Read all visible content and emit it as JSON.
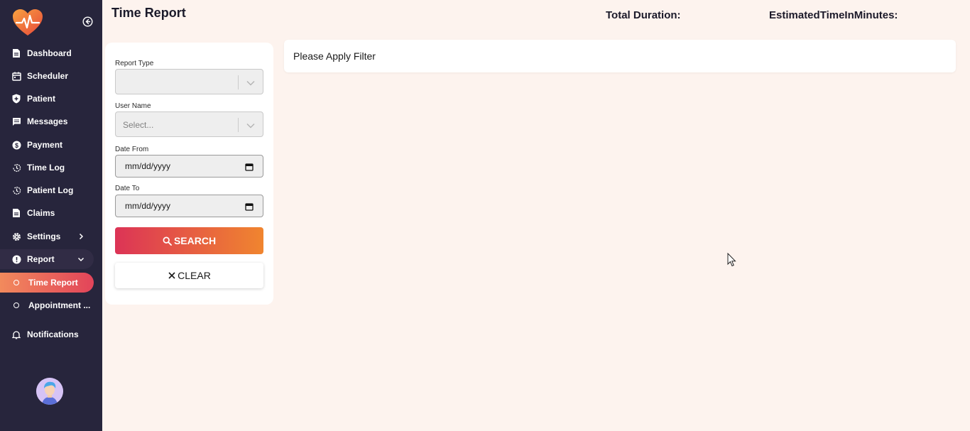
{
  "sidebar": {
    "items": [
      {
        "label": "Dashboard",
        "icon": "document-icon"
      },
      {
        "label": "Scheduler",
        "icon": "calendar-icon"
      },
      {
        "label": "Patient",
        "icon": "shield-icon"
      },
      {
        "label": "Messages",
        "icon": "message-icon"
      },
      {
        "label": "Payment",
        "icon": "dollar-icon"
      },
      {
        "label": "Time Log",
        "icon": "history-icon"
      },
      {
        "label": "Patient Log",
        "icon": "history-icon"
      },
      {
        "label": "Claims",
        "icon": "document-icon"
      },
      {
        "label": "Settings",
        "icon": "gear-icon"
      },
      {
        "label": "Report",
        "icon": "alert-icon"
      }
    ],
    "sub_items": [
      {
        "label": "Time Report"
      },
      {
        "label": "Appointment ..."
      }
    ],
    "notifications": {
      "label": "Notifications",
      "icon": "bell-icon"
    }
  },
  "header": {
    "title": "Time Report",
    "total_duration_label": "Total Duration:",
    "estimated_time_label": "EstimatedTimeInMinutes:"
  },
  "filters": {
    "report_type": {
      "label": "Report Type",
      "value": ""
    },
    "user_name": {
      "label": "User Name",
      "placeholder": "Select..."
    },
    "date_from": {
      "label": "Date From",
      "value": "mm/dd/yyyy"
    },
    "date_to": {
      "label": "Date To",
      "value": "mm/dd/yyyy"
    },
    "search_label": "SEARCH",
    "clear_label": "CLEAR"
  },
  "result": {
    "message": "Please Apply Filter"
  },
  "colors": {
    "sidebar_bg": "#27253c",
    "page_bg": "#fdf3ee",
    "accent_start": "#dc3456",
    "accent_end": "#f0852f"
  }
}
